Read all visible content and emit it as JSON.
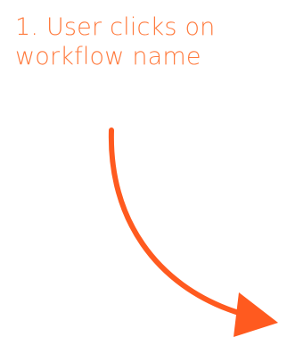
{
  "annotation": {
    "step_text_line1": "1. User clicks on",
    "step_text_line2": "workflow name"
  },
  "colors": {
    "accent": "#FF5A1F",
    "text": "#FF7A3D",
    "background": "#FFFFFF"
  },
  "icons": {
    "arrow": "curved-arrow-down-right"
  }
}
